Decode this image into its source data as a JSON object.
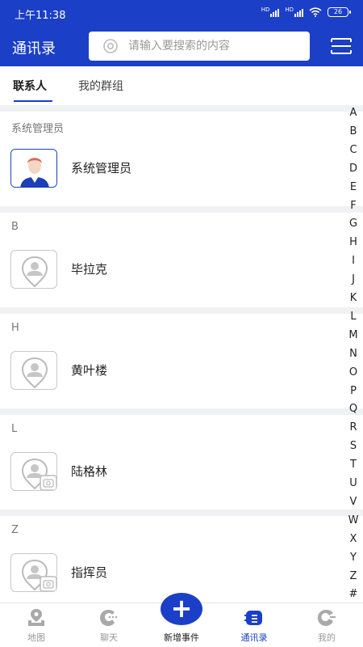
{
  "status": {
    "time": "上午11:38",
    "battery": "26",
    "sim1": "HD",
    "sim2": "HD"
  },
  "header": {
    "title": "通讯录",
    "search_placeholder": "请输入要搜索的内容"
  },
  "tabs": [
    {
      "label": "联系人",
      "active": true
    },
    {
      "label": "我的群组",
      "active": false
    }
  ],
  "sections": [
    {
      "header": "系统管理员",
      "contacts": [
        {
          "name": "系统管理员",
          "avatar": "photo"
        }
      ]
    },
    {
      "header": "B",
      "contacts": [
        {
          "name": "毕拉克",
          "avatar": "placeholder"
        }
      ]
    },
    {
      "header": "H",
      "contacts": [
        {
          "name": "黄叶楼",
          "avatar": "placeholder"
        }
      ]
    },
    {
      "header": "L",
      "contacts": [
        {
          "name": "陆格林",
          "avatar": "placeholder-camera"
        }
      ]
    },
    {
      "header": "Z",
      "contacts": [
        {
          "name": "指挥员",
          "avatar": "placeholder-camera"
        }
      ]
    }
  ],
  "alphabet": [
    "A",
    "B",
    "C",
    "D",
    "E",
    "F",
    "G",
    "H",
    "I",
    "J",
    "K",
    "L",
    "M",
    "N",
    "O",
    "P",
    "Q",
    "R",
    "S",
    "T",
    "U",
    "V",
    "W",
    "X",
    "Y",
    "Z",
    "#"
  ],
  "bottom_nav": {
    "map": "地图",
    "chat": "聊天",
    "add_event": "新增事件",
    "contacts": "通讯录",
    "mine": "我的"
  },
  "colors": {
    "primary": "#1b3fc6",
    "background": "#f0f1f3"
  }
}
